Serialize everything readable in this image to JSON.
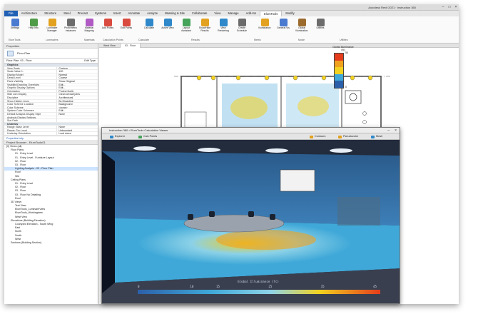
{
  "window": {
    "title": "Autodesk Revit 2021 · Instruction 360"
  },
  "ribbon_tabs": [
    "File",
    "Architecture",
    "Structure",
    "Steel",
    "Precast",
    "Systems",
    "Insert",
    "Annotate",
    "Analyze",
    "Massing & Site",
    "Collaborate",
    "View",
    "Manage",
    "Add-Ins",
    "ElumTools",
    "Modify"
  ],
  "ribbon": {
    "buttons": [
      {
        "label": "Settings",
        "color": "#4b7bd0"
      },
      {
        "label": "Help Info",
        "color": "#4f9b47"
      },
      {
        "label": "Luminaire Manager",
        "color": "#e2a11e"
      },
      {
        "label": "Photometric Instances",
        "color": "#6c6c6c"
      },
      {
        "label": "Material Mapping",
        "color": "#b05ac4"
      },
      {
        "label": "Add Points",
        "color": "#d94b3f"
      },
      {
        "label": "Edit Points",
        "color": "#d94b3f"
      },
      {
        "label": "Calculate",
        "color": "#2e88c9"
      },
      {
        "label": "Active View",
        "color": "#2e88c9"
      },
      {
        "label": "Layout Assistant",
        "color": "#46a35a"
      },
      {
        "label": "Show/Hide Results",
        "color": "#e2a11e"
      },
      {
        "label": "View Rendering",
        "color": "#2e88c9"
      },
      {
        "label": "Create Schedule",
        "color": "#6c6c6c"
      },
      {
        "label": "Illuminance",
        "color": "#e2a11e"
      },
      {
        "label": "General Vis",
        "color": "#4b7bd0"
      },
      {
        "label": "Global Illumination",
        "color": "#9b6b2e"
      },
      {
        "label": "Utilities",
        "color": "#6c6c6c"
      }
    ],
    "groups": [
      "ElumTools",
      "Luminaires",
      "Materials",
      "Calculation Points",
      "Calculate",
      "Results",
      "Metric",
      "Mode",
      "Utilities"
    ]
  },
  "properties": {
    "header": "Properties",
    "type_name": "Floor Plan",
    "instance_label": "Floor Plan: 03 - Floor",
    "edit_type": "Edit Type",
    "rows": [
      {
        "k": "Graphics",
        "v": "",
        "section": true
      },
      {
        "k": "View Scale",
        "v": "Custom"
      },
      {
        "k": "Scale Value 1:",
        "v": "100"
      },
      {
        "k": "Display Model",
        "v": "Normal"
      },
      {
        "k": "Detail Level",
        "v": "Coarse"
      },
      {
        "k": "Parts Visibility",
        "v": "Show Original"
      },
      {
        "k": "Visibility/Graphics Overrides",
        "v": "Edit..."
      },
      {
        "k": "Graphic Display Options",
        "v": "Edit..."
      },
      {
        "k": "Orientation",
        "v": "Project North"
      },
      {
        "k": "Wall Join Display",
        "v": "Clean all wall joins"
      },
      {
        "k": "Discipline",
        "v": "Architectural"
      },
      {
        "k": "Show Hidden Lines",
        "v": "By Discipline"
      },
      {
        "k": "Color Scheme Location",
        "v": "Background"
      },
      {
        "k": "Color Scheme",
        "v": "<none>"
      },
      {
        "k": "System Color Schemes",
        "v": "Edit..."
      },
      {
        "k": "Default Analysis Display Style",
        "v": "None"
      },
      {
        "k": "Analysis Display Settings",
        "v": ""
      },
      {
        "k": "Sun Path",
        "v": ""
      },
      {
        "k": "Underlay",
        "v": "",
        "section": true
      },
      {
        "k": "Range: Base Level",
        "v": "None"
      },
      {
        "k": "Range: Top Level",
        "v": "Unbounded"
      },
      {
        "k": "Underlay Orientation",
        "v": "Look down"
      }
    ],
    "help_link": "Properties help",
    "apply": "Apply"
  },
  "project_browser": {
    "header": "Project Browser - ElumTools01",
    "items": [
      {
        "label": "[0] Views (all)",
        "indent": 0
      },
      {
        "label": "Floor Plans",
        "indent": 1
      },
      {
        "label": "01 - Entry Level",
        "indent": 2
      },
      {
        "label": "01 - Entry Level - Furniture Layout",
        "indent": 2
      },
      {
        "label": "02 - Floor",
        "indent": 2
      },
      {
        "label": "03 - Floor",
        "indent": 2
      },
      {
        "label": "Lighting Analysis - 03 - Floor Plan",
        "indent": 2,
        "selected": true
      },
      {
        "label": "Roof",
        "indent": 2
      },
      {
        "label": "Site",
        "indent": 2
      },
      {
        "label": "Ceiling Plans",
        "indent": 1
      },
      {
        "label": "01 - Entry Level",
        "indent": 2
      },
      {
        "label": "02 - Floor",
        "indent": 2
      },
      {
        "label": "03 - Floor",
        "indent": 2
      },
      {
        "label": "03 - Floor No Detailing",
        "indent": 2
      },
      {
        "label": "Roof",
        "indent": 2
      },
      {
        "label": "3D Views",
        "indent": 1
      },
      {
        "label": "Test View",
        "indent": 2
      },
      {
        "label": "ElumTools_LuminaireView",
        "indent": 2
      },
      {
        "label": "ElumTools_Workingview",
        "indent": 2
      },
      {
        "label": "West View",
        "indent": 2
      },
      {
        "label": "Elevations (Building Elevation)",
        "indent": 1
      },
      {
        "label": "Courtyard Elevation - South Wing",
        "indent": 2
      },
      {
        "label": "East",
        "indent": 2
      },
      {
        "label": "North",
        "indent": 2
      },
      {
        "label": "South",
        "indent": 2
      },
      {
        "label": "West",
        "indent": 2
      },
      {
        "label": "Sections (Building Section)",
        "indent": 1
      }
    ]
  },
  "view_tabs": [
    {
      "label": "West View",
      "active": false
    },
    {
      "label": "03 - Floor",
      "active": true
    }
  ],
  "legend": {
    "title": "Global Illuminance",
    "unit": "(fc)",
    "max": "54",
    "min": "0",
    "colors": [
      "#e53c1c",
      "#f0a11e",
      "#f3d21f",
      "#3fa8d8",
      "#2c5fa9"
    ]
  },
  "calc_window": {
    "title": "Instruction 360 • ElumTools Calculation Viewer",
    "toolbar": [
      {
        "label": "Contours",
        "color": "#e2a11e"
      },
      {
        "label": "Pseudocolor",
        "color": "#e2a11e"
      },
      {
        "label": "Mesh",
        "color": "#2e88c9"
      },
      {
        "label": "Explorer",
        "color": "#2e88c9"
      },
      {
        "label": "Calc Points",
        "color": "#46a35a"
      }
    ],
    "scale": {
      "label": "Global Illuminance (fc)",
      "ticks": [
        "0",
        "10",
        "15",
        "25",
        "35",
        "45"
      ]
    }
  }
}
